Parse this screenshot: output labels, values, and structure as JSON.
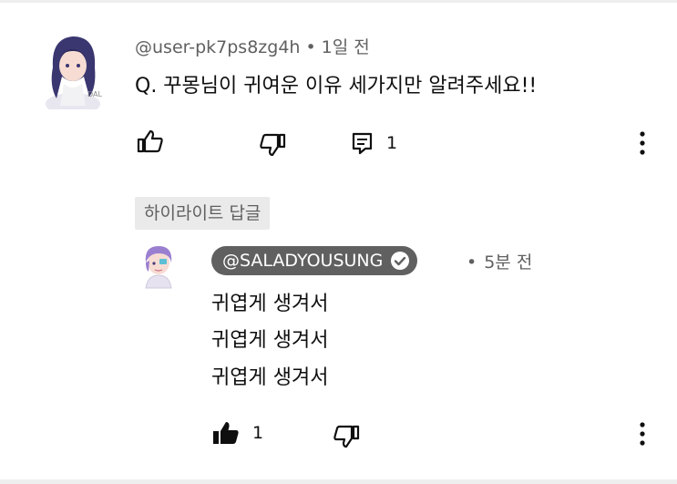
{
  "comment": {
    "username": "@user-pk7ps8zg4h",
    "separator": "•",
    "time": "1일 전",
    "text": "Q. 꾸몽님이 귀여운 이유 세가지만 알려주세요!!",
    "reply_count": "1"
  },
  "highlighted_label": "하이라이트 답글",
  "reply": {
    "channel": "@SALADYOUSUNG",
    "separator": "•",
    "time": "5분 전",
    "lines": [
      "귀엽게 생겨서",
      "귀엽게 생겨서",
      "귀엽게 생겨서"
    ],
    "like_count": "1"
  },
  "colors": {
    "text": "#0f0f0f",
    "secondary": "#606060",
    "chip": "#606060",
    "label_bg": "#eaeaea"
  },
  "icons": [
    "like-icon",
    "dislike-icon",
    "reply-icon",
    "more-icon",
    "liked-icon",
    "verified-icon"
  ]
}
